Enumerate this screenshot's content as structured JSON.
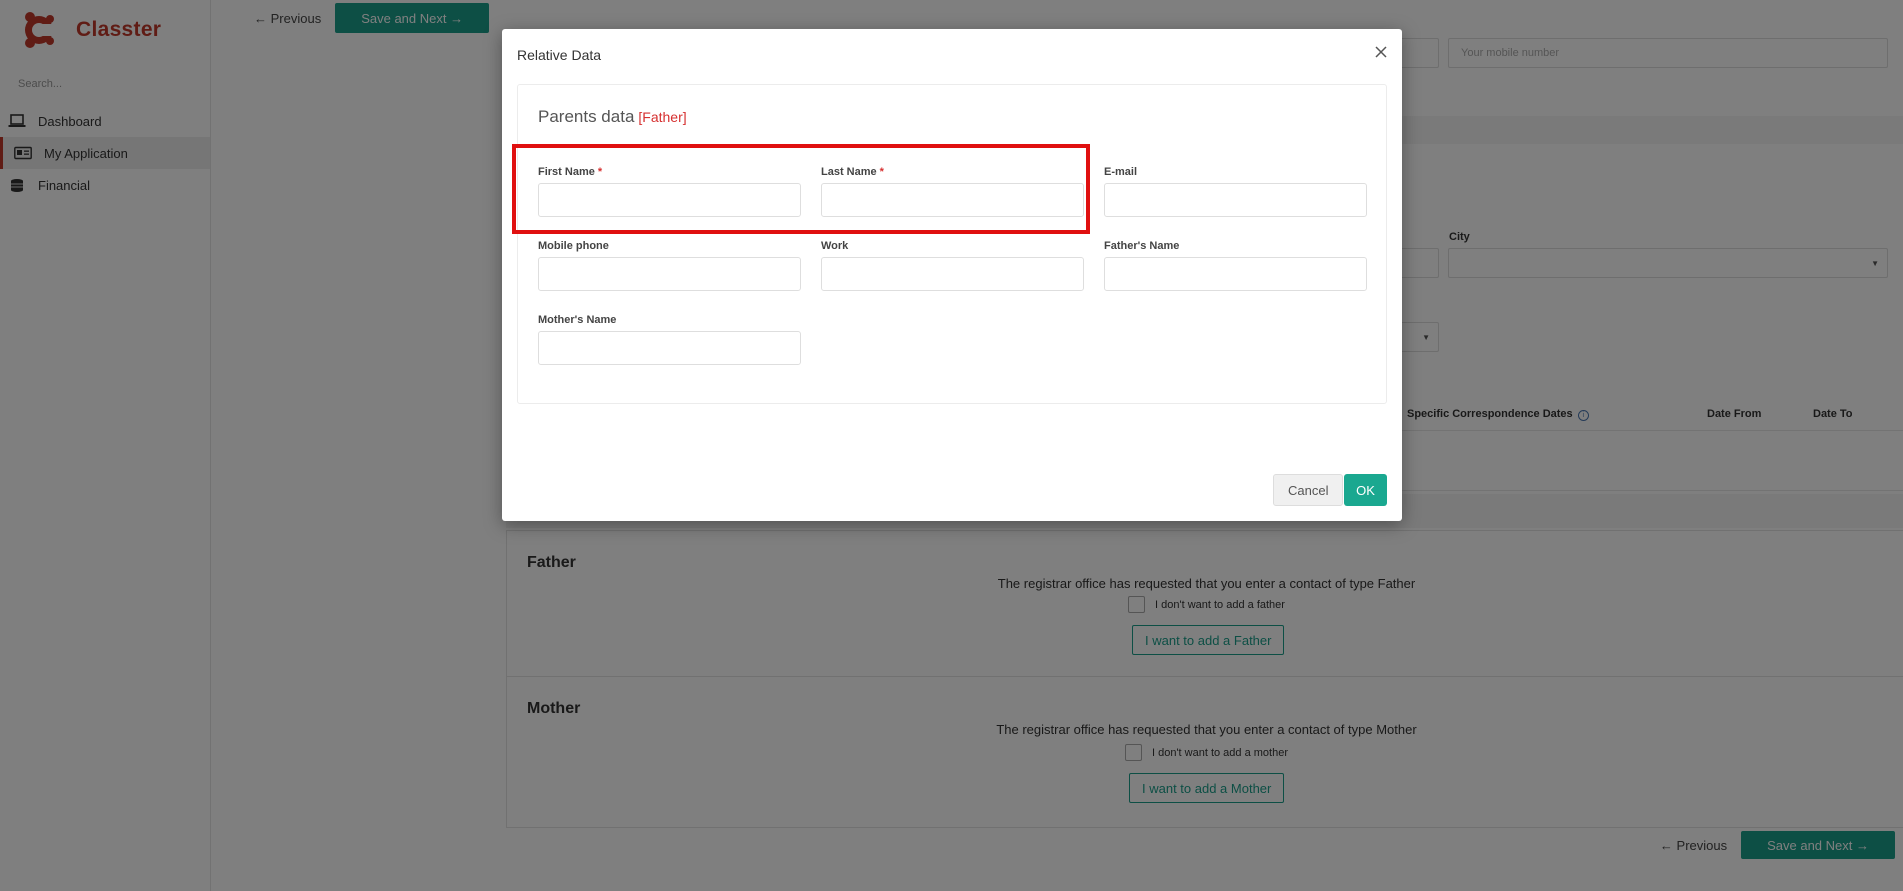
{
  "sidebar": {
    "brand": "Classter",
    "search_placeholder": "Search...",
    "items": [
      {
        "label": "Dashboard",
        "icon": "laptop-icon"
      },
      {
        "label": "My Application",
        "icon": "id-card-icon"
      },
      {
        "label": "Financial",
        "icon": "coins-icon"
      }
    ]
  },
  "top_bar": {
    "previous": "← Previous",
    "save_next": "Save and Next →"
  },
  "background": {
    "mobile_placeholder": "Your mobile number",
    "city_label": "City",
    "table_headers": [
      "Specific Correspondence Dates",
      "Date From",
      "Date To"
    ]
  },
  "father_section": {
    "title": "Father",
    "message": "The registrar office has requested that you enter a contact of type Father",
    "checkbox_label": "I don't want to add a father",
    "add_button": "I want to add a Father"
  },
  "mother_section": {
    "title": "Mother",
    "message": "The registrar office has requested that you enter a contact of type Mother",
    "checkbox_label": "I don't want to add a mother",
    "add_button": "I want to add a Mother"
  },
  "bottom_bar": {
    "previous": "← Previous",
    "save_next": "Save and Next →"
  },
  "modal": {
    "title": "Relative Data",
    "panel_title": "Parents data",
    "panel_tag": "[Father]",
    "fields": {
      "first_name": "First Name",
      "last_name": "Last Name",
      "email": "E-mail",
      "mobile_phone": "Mobile phone",
      "work": "Work",
      "fathers_name": "Father's Name",
      "mothers_name": "Mother's Name"
    },
    "required_mark": "*",
    "cancel": "Cancel",
    "ok": "OK"
  },
  "colors": {
    "brand": "#c0392b",
    "teal": "#1a9e8a",
    "required": "#d63030",
    "highlight": "#e01010"
  }
}
